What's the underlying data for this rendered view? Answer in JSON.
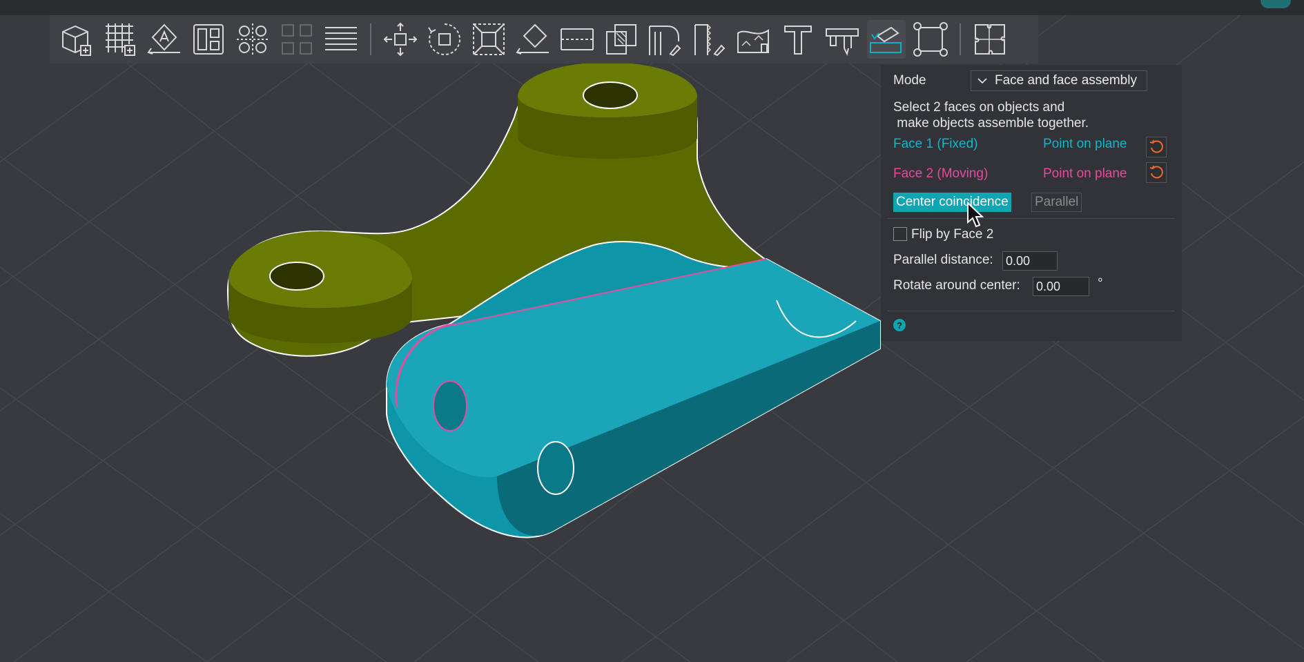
{
  "toolbar": {
    "tools": [
      {
        "icon": "add-box-icon"
      },
      {
        "icon": "add-grid-icon"
      },
      {
        "icon": "annotate-plane-icon"
      },
      {
        "icon": "layout-icon"
      },
      {
        "icon": "pattern-icon"
      },
      {
        "icon": "pattern-disabled-icon"
      },
      {
        "icon": "lines-icon"
      },
      {
        "icon": "move-icon"
      },
      {
        "icon": "rotate-icon"
      },
      {
        "icon": "scale-icon"
      },
      {
        "icon": "place-on-face-icon"
      },
      {
        "icon": "split-icon"
      },
      {
        "icon": "boolean-icon"
      },
      {
        "icon": "brush-corner-icon"
      },
      {
        "icon": "zigzag-brush-icon"
      },
      {
        "icon": "texture-icon"
      },
      {
        "icon": "text-icon"
      },
      {
        "icon": "measure-icon"
      },
      {
        "icon": "assembly-icon",
        "active": true
      },
      {
        "icon": "drill-icon"
      },
      {
        "icon": "puzzle-icon"
      }
    ]
  },
  "panel": {
    "mode_label": "Mode",
    "mode_value": "Face and face assembly",
    "instruction": "Select 2 faces on objects and\n make objects assemble together.",
    "face1_label": "Face 1 (Fixed)",
    "face1_pick": "Point on plane",
    "face2_label": "Face 2 (Moving)",
    "face2_pick": "Point on plane",
    "center_button": "Center coincidence",
    "parallel_button": "Parallel",
    "flip_label": "Flip by Face 2",
    "flip_checked": false,
    "parallel_distance_label": "Parallel distance:",
    "parallel_distance_value": "0.00",
    "rotate_label": "Rotate around center:",
    "rotate_value": "0.00",
    "rotate_unit": "°",
    "help_glyph": "?"
  },
  "colors": {
    "background": "#393a3f",
    "accent": "#0fa5b3",
    "face1": "#11b6c9",
    "face2": "#e74a9e",
    "reset": "#f06a27",
    "part_fixed": "#5c6b00",
    "part_moving": "#0f95a8"
  }
}
